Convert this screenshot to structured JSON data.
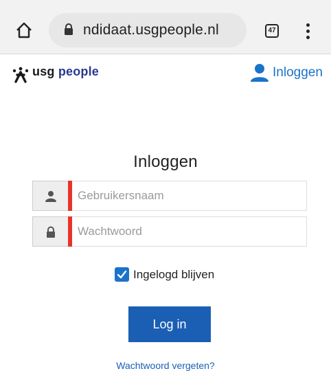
{
  "browser": {
    "url": "ndidaat.usgpeople.nl",
    "tab_count": "47"
  },
  "header": {
    "logo_text_usg": "usg",
    "logo_text_people": "people",
    "login_link_label": "Inloggen"
  },
  "login_form": {
    "title": "Inloggen",
    "username_placeholder": "Gebruikersnaam",
    "password_placeholder": "Wachtwoord",
    "remember_label": "Ingelogd blijven",
    "remember_checked": true,
    "submit_label": "Log in",
    "forgot_label": "Wachtwoord vergeten?"
  },
  "colors": {
    "accent_blue": "#1a5fb4",
    "link_blue": "#1a73c9",
    "field_marker_red": "#e8332a"
  }
}
